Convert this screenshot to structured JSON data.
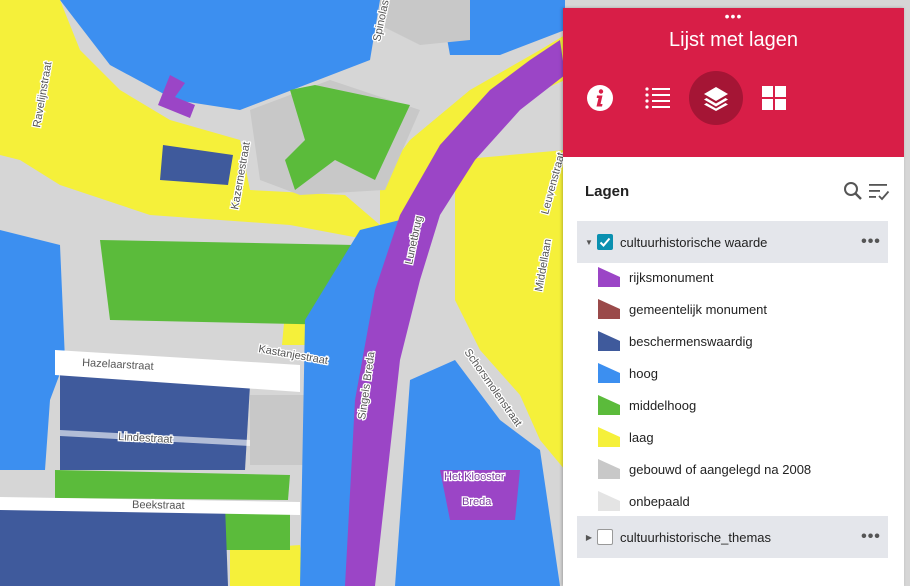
{
  "map": {
    "street_labels": [
      "Ravelijnstraat",
      "Kazernestraat",
      "Hazelaarstraat",
      "Kastanjestraat",
      "Lindestraat",
      "Beekstraat",
      "Singels Breda",
      "Lunetbrug",
      "Schorsmolenstraat",
      "Middellaan",
      "Leuvenstraat",
      "Spinolastraat"
    ],
    "poi_label_1": "Het Klooster",
    "poi_label_2": "Breda"
  },
  "panel": {
    "drag_handle": "•••",
    "title": "Lijst met lagen",
    "tabs": [
      {
        "name": "info",
        "icon": "info-icon",
        "active": false
      },
      {
        "name": "legend",
        "icon": "list-icon",
        "active": false
      },
      {
        "name": "layers",
        "icon": "layers-icon",
        "active": true
      },
      {
        "name": "basemap",
        "icon": "grid-icon",
        "active": false
      }
    ],
    "header_color": "#d81e47"
  },
  "layers": {
    "title": "Lagen",
    "search_icon": "search-icon",
    "filter_icon": "filter-list-icon",
    "groups": [
      {
        "label": "cultuurhistorische waarde",
        "checked": true,
        "expanded": true,
        "more": "•••"
      },
      {
        "label": "cultuurhistorische_themas",
        "checked": false,
        "expanded": false,
        "more": "•••"
      }
    ],
    "legend": [
      {
        "label": "rijksmonument",
        "color": "#9b45c6"
      },
      {
        "label": "gemeentelijk monument",
        "color": "#9a4a4a"
      },
      {
        "label": "beschermenswaardig",
        "color": "#3f5a9c"
      },
      {
        "label": "hoog",
        "color": "#3c8ff0"
      },
      {
        "label": "middelhoog",
        "color": "#5bbb3b"
      },
      {
        "label": "laag",
        "color": "#f5f03a"
      },
      {
        "label": "gebouwd of aangelegd na 2008",
        "color": "#c8c8c8"
      },
      {
        "label": "onbepaald",
        "color": "#e4e4e4"
      }
    ]
  }
}
